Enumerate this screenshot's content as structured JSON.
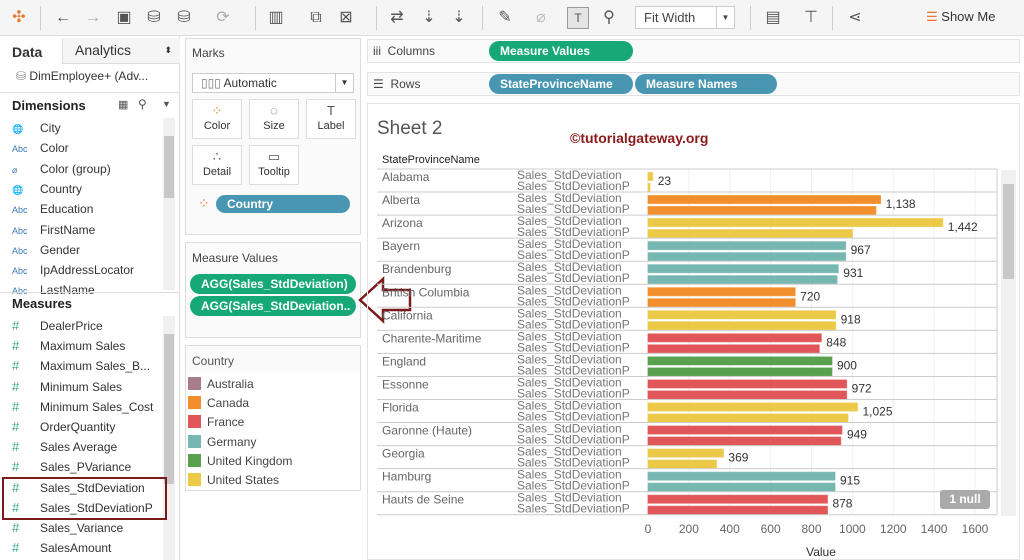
{
  "toolbar": {
    "fit_width": "Fit Width",
    "show_me": "Show Me"
  },
  "left_panel": {
    "tabs": [
      "Data",
      "Analytics"
    ],
    "datasource": "DimEmployee+ (Adv...",
    "dimensions_title": "Dimensions",
    "dimensions": [
      {
        "type": "globe",
        "label": "City"
      },
      {
        "type": "Abc",
        "label": "Color"
      },
      {
        "type": "clip",
        "label": "Color (group)"
      },
      {
        "type": "globe",
        "label": "Country"
      },
      {
        "type": "Abc",
        "label": "Education"
      },
      {
        "type": "Abc",
        "label": "FirstName"
      },
      {
        "type": "Abc",
        "label": "Gender"
      },
      {
        "type": "Abc",
        "label": "IpAddressLocator"
      },
      {
        "type": "Abc",
        "label": "LastName"
      }
    ],
    "measures_title": "Measures",
    "measures": [
      "DealerPrice",
      "Maximum Sales",
      "Maximum Sales_B...",
      "Minimum Sales",
      "Minimum Sales_Cost",
      "OrderQuantity",
      "Sales Average",
      "Sales_PVariance",
      "Sales_StdDeviation",
      "Sales_StdDeviationP",
      "Sales_Variance",
      "SalesAmount"
    ]
  },
  "marks": {
    "title": "Marks",
    "type": "Automatic",
    "buttons": [
      "Color",
      "Size",
      "Label",
      "Detail",
      "Tooltip"
    ],
    "color_pill": "Country"
  },
  "measure_values": {
    "title": "Measure Values",
    "pills": [
      "AGG(Sales_StdDeviation)",
      "AGG(Sales_StdDeviation.."
    ]
  },
  "legend": {
    "title": "Country",
    "items": [
      {
        "label": "Australia",
        "color": "#a87c8b"
      },
      {
        "label": "Canada",
        "color": "#f28e2b"
      },
      {
        "label": "France",
        "color": "#e15759"
      },
      {
        "label": "Germany",
        "color": "#76b7b2"
      },
      {
        "label": "United Kingdom",
        "color": "#59a14f"
      },
      {
        "label": "United States",
        "color": "#edc948"
      }
    ]
  },
  "shelves": {
    "columns_label": "Columns",
    "columns_pills": [
      "Measure Values"
    ],
    "rows_label": "Rows",
    "rows_pills": [
      "StateProvinceName",
      "Measure Names"
    ]
  },
  "sheet": {
    "title": "Sheet 2",
    "watermark": "©tutorialgateway.org",
    "null_badge": "1 null"
  },
  "chart_data": {
    "type": "bar",
    "row_header": "StateProvinceName",
    "xlabel": "Value",
    "xlim": [
      0,
      1600
    ],
    "xticks": [
      0,
      200,
      400,
      600,
      800,
      1000,
      1200,
      1400,
      1600
    ],
    "series_names": [
      "Sales_StdDeviation",
      "Sales_StdDeviationP"
    ],
    "rows": [
      {
        "state": "Alabama",
        "country": "United States",
        "values": [
          23,
          10
        ],
        "label": "23"
      },
      {
        "state": "Alberta",
        "country": "Canada",
        "values": [
          1138,
          1115
        ],
        "label": "1,138"
      },
      {
        "state": "Arizona",
        "country": "United States",
        "values": [
          1442,
          1000
        ],
        "label": "1,442"
      },
      {
        "state": "Bayern",
        "country": "Germany",
        "values": [
          967,
          967
        ],
        "label": "967"
      },
      {
        "state": "Brandenburg",
        "country": "Germany",
        "values": [
          931,
          925
        ],
        "label": "931"
      },
      {
        "state": "British Columbia",
        "country": "Canada",
        "values": [
          720,
          720
        ],
        "label": "720"
      },
      {
        "state": "California",
        "country": "United States",
        "values": [
          918,
          918
        ],
        "label": "918"
      },
      {
        "state": "Charente-Maritime",
        "country": "France",
        "values": [
          848,
          838
        ],
        "label": "848"
      },
      {
        "state": "England",
        "country": "United Kingdom",
        "values": [
          900,
          900
        ],
        "label": "900"
      },
      {
        "state": "Essonne",
        "country": "France",
        "values": [
          972,
          972
        ],
        "label": "972"
      },
      {
        "state": "Florida",
        "country": "United States",
        "values": [
          1025,
          978
        ],
        "label": "1,025"
      },
      {
        "state": "Garonne (Haute)",
        "country": "France",
        "values": [
          949,
          943
        ],
        "label": "949"
      },
      {
        "state": "Georgia",
        "country": "United States",
        "values": [
          369,
          335
        ],
        "label": "369"
      },
      {
        "state": "Hamburg",
        "country": "Germany",
        "values": [
          915,
          915
        ],
        "label": "915"
      },
      {
        "state": "Hauts de Seine",
        "country": "France",
        "values": [
          878,
          878
        ],
        "label": "878"
      }
    ]
  }
}
